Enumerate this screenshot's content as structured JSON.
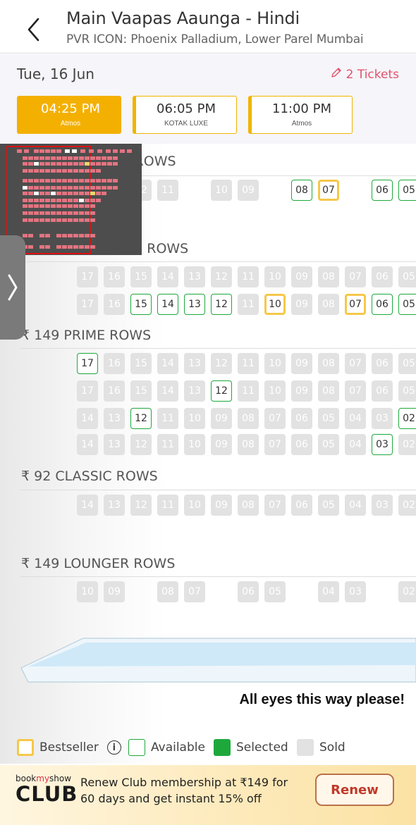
{
  "header": {
    "title": "Main Vaapas Aaunga - Hindi",
    "subtitle": "PVR ICON: Phoenix Palladium, Lower Parel Mumbai"
  },
  "topbar": {
    "date": "Tue, 16 Jun",
    "tickets": "2 Tickets"
  },
  "showtimes": [
    {
      "time": "04:25 PM",
      "format": "Atmos",
      "selected": true
    },
    {
      "time": "06:05 PM",
      "format": "KOTAK LUXE",
      "selected": false
    },
    {
      "time": "11:00 PM",
      "format": "Atmos",
      "selected": false
    }
  ],
  "categories": [
    {
      "label": "₹ 299 RECLINER ROWS"
    },
    {
      "label": "₹ 149 PRIME PLUS ROWS"
    },
    {
      "label": "₹ 149 PRIME ROWS"
    },
    {
      "label": "₹ 92 CLASSIC ROWS"
    },
    {
      "label": "₹ 149 LOUNGER ROWS"
    }
  ],
  "screen_text": "All eyes this way please!",
  "legend": {
    "bestseller": "Bestseller",
    "available": "Available",
    "selected": "Selected",
    "sold": "Sold"
  },
  "banner": {
    "club_top_prefix": "book",
    "club_top_my": "my",
    "club_top_suffix": "show",
    "club_name": "CLUB",
    "text": "Renew Club membership at ₹149 for 60 days and get instant 15% off",
    "button": "Renew"
  },
  "colors": {
    "accent": "#f4b000",
    "tickets": "#e2536b",
    "available": "#1ea83c",
    "bestseller": "#f5c84a",
    "sold": "#e2e2e2"
  }
}
